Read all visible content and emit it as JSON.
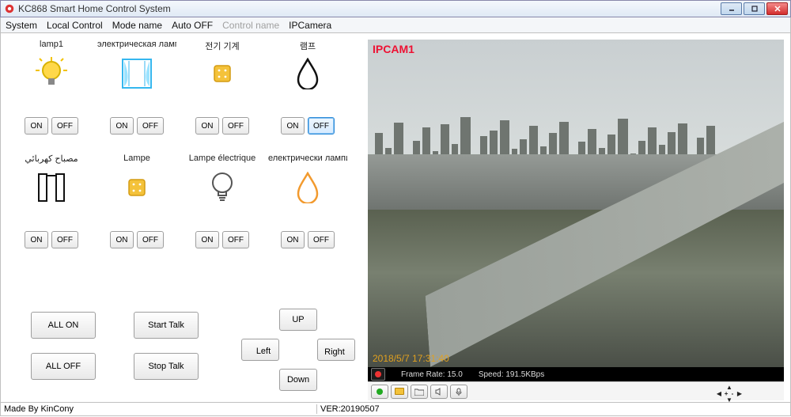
{
  "titlebar": {
    "title": "KC868 Smart Home Control System"
  },
  "menu": {
    "items": [
      {
        "label": "System",
        "disabled": false
      },
      {
        "label": "Local Control",
        "disabled": false
      },
      {
        "label": "Mode name",
        "disabled": false
      },
      {
        "label": "Auto OFF",
        "disabled": false
      },
      {
        "label": "Control name",
        "disabled": true
      },
      {
        "label": "IPCamera",
        "disabled": false
      }
    ]
  },
  "devices": [
    {
      "name": "lamp1",
      "icon": "bulb-lit",
      "on": "ON",
      "off": "OFF"
    },
    {
      "name": "электрическая лампа",
      "icon": "curtain",
      "on": "ON",
      "off": "OFF"
    },
    {
      "name": "전기 기계",
      "icon": "square-yellow",
      "on": "ON",
      "off": "OFF"
    },
    {
      "name": "램프",
      "icon": "drop-outline",
      "on": "ON",
      "off": "OFF",
      "off_active": true
    },
    {
      "name": "مصباح كهربائي",
      "icon": "doorframe",
      "on": "ON",
      "off": "OFF"
    },
    {
      "name": "Lampe",
      "icon": "square-yellow",
      "on": "ON",
      "off": "OFF"
    },
    {
      "name": "Lampe électrique",
      "icon": "bulb-outline",
      "on": "ON",
      "off": "OFF"
    },
    {
      "name": "електрически лампи",
      "icon": "drop-orange",
      "on": "ON",
      "off": "OFF"
    }
  ],
  "controls": {
    "all_on": "ALL ON",
    "all_off": "ALL OFF",
    "start_talk": "Start Talk",
    "stop_talk": "Stop Talk",
    "up": "UP",
    "down": "Down",
    "left": "Left",
    "right": "Right"
  },
  "camera": {
    "label": "IPCAM1",
    "timestamp": "2018/5/7 17:31:40",
    "frame_rate_label": "Frame Rate:",
    "frame_rate": "15.0",
    "speed_label": "Speed:",
    "speed": "191.5KBps"
  },
  "footer": {
    "made": "Made By KinCony",
    "ver": "VER:20190507"
  }
}
